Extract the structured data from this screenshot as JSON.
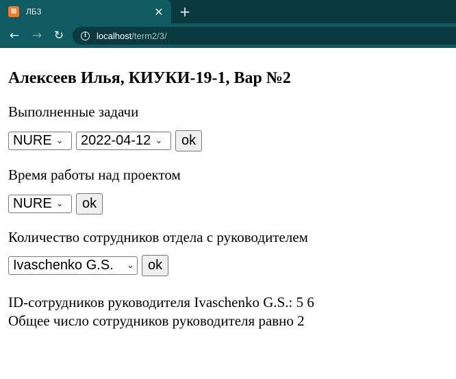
{
  "browser": {
    "tab_title": "ЛБ3",
    "favicon_label": "⊠",
    "close_glyph": "✕",
    "newtab_glyph": "+",
    "back_glyph": "←",
    "forward_glyph": "→",
    "reload_glyph": "↻",
    "info_glyph": "i",
    "url_host": "localhost",
    "url_path": "/term2/3/"
  },
  "page": {
    "heading": "Алексеев Илья, КИУКИ-19-1, Вар №2",
    "section1": {
      "label": "Выполненные задачи",
      "select1_value": "NURE",
      "select2_value": "2022-04-12",
      "button": "ok"
    },
    "section2": {
      "label": "Время работы над проектом",
      "select_value": "NURE",
      "button": "ok"
    },
    "section3": {
      "label": "Количество сотрудников отдела с руководителем",
      "select_value": "Ivaschenko G.S.",
      "button": "ok"
    },
    "results": {
      "line1": "ID-сотрудников руководителя Ivaschenko G.S.: 5 6",
      "line2": "Общее число сотрудников руководителя равно 2"
    },
    "chevron_glyph": "⌄"
  },
  "colors": {
    "tabstrip_bg": "#0b3a3e",
    "toolbar_bg": "#0f5b61",
    "favicon_bg": "#f27b2a"
  }
}
